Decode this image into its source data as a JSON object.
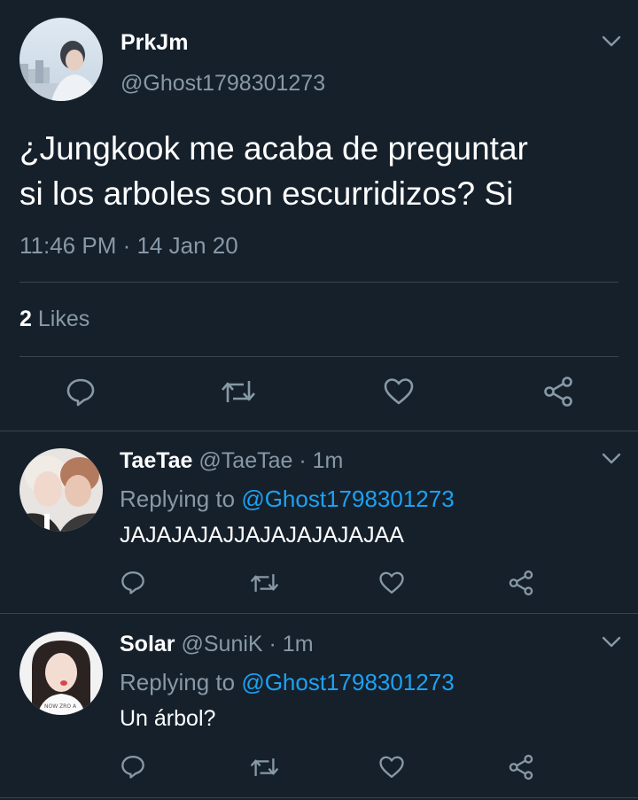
{
  "main_tweet": {
    "author_name": "PrkJm",
    "author_handle": "@Ghost1798301273",
    "text_line1": "¿Jungkook me acaba de preguntar",
    "text_line2": "si los arboles son escurridizos? Si",
    "timestamp": "11:46 PM · 14 Jan 20",
    "likes_count": "2",
    "likes_label": "Likes"
  },
  "replies": [
    {
      "author_name": "TaeTae",
      "meta": "@TaeTae · 1m",
      "replying_prefix": "Replying to",
      "replying_handle": "@Ghost1798301273",
      "text": "JAJAJAJAJJAJAJAJAJAJAA"
    },
    {
      "author_name": "Solar",
      "meta": "@SuniK · 1m",
      "replying_prefix": "Replying to",
      "replying_handle": "@Ghost1798301273",
      "text": "Un árbol?"
    }
  ],
  "colors": {
    "background": "#15202b",
    "muted": "#8899a6",
    "link": "#1da1f2",
    "divider": "#38444d"
  },
  "icons": [
    "chevron-down-icon",
    "reply-icon",
    "retweet-icon",
    "like-icon",
    "share-icon"
  ]
}
